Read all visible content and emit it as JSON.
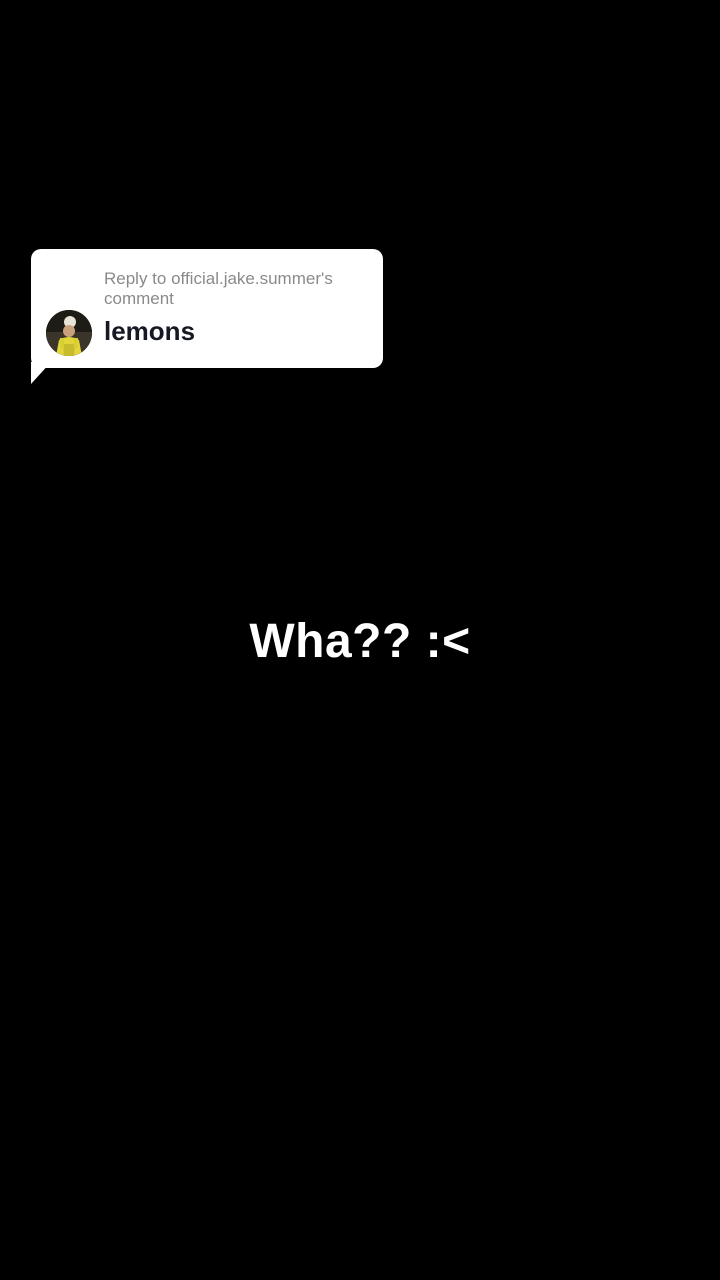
{
  "reply_sticker": {
    "header": "Reply to official.jake.summer's comment",
    "comment": "lemons",
    "avatar_icon": "user-avatar"
  },
  "caption": {
    "text": "Wha?? :<"
  },
  "colors": {
    "background": "#000000",
    "bubble": "#ffffff",
    "header_text": "#8a8a8a",
    "comment_text": "#161823",
    "caption_text": "#ffffff"
  }
}
